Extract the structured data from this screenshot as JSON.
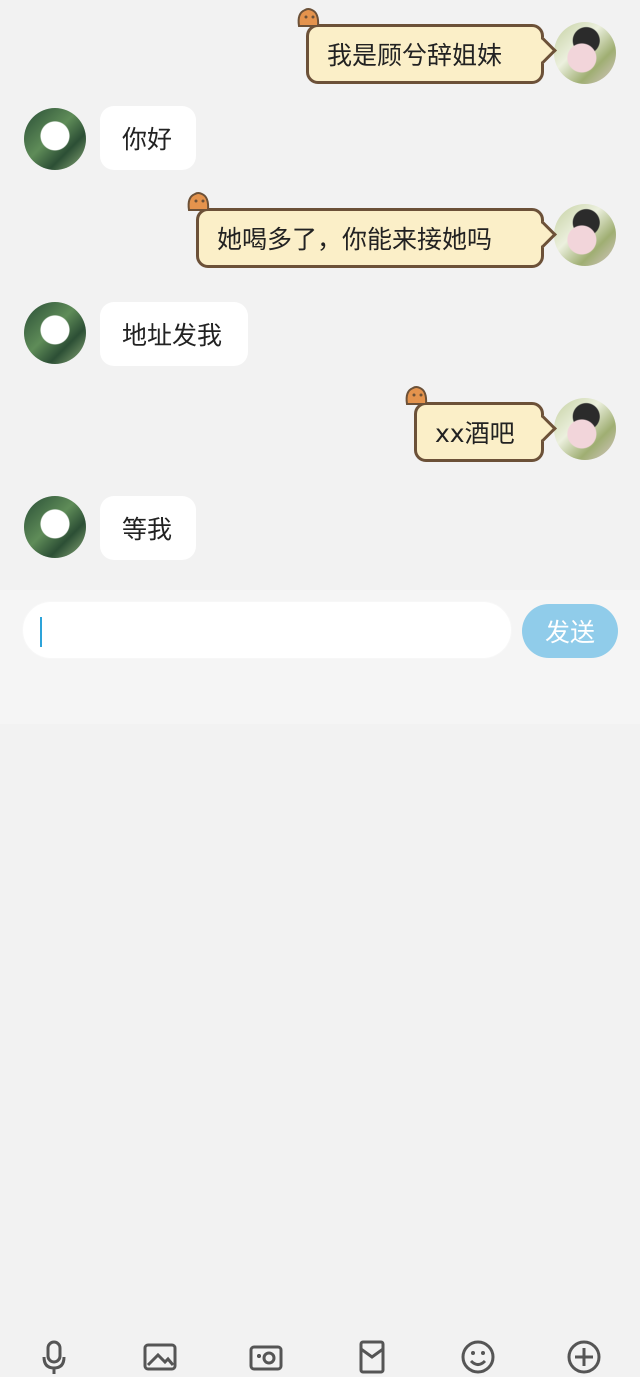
{
  "messages": [
    {
      "side": "right",
      "text": "我是顾兮辞姐妹"
    },
    {
      "side": "left",
      "text": "你好"
    },
    {
      "side": "right",
      "text": "她喝多了，你能来接她吗"
    },
    {
      "side": "left",
      "text": "地址发我"
    },
    {
      "side": "right",
      "text": "xx酒吧"
    },
    {
      "side": "left",
      "text": "等我"
    }
  ],
  "composer": {
    "send_label": "发送"
  },
  "toolbar": {
    "icons": [
      "microphone-icon",
      "image-icon",
      "camera-icon",
      "red-envelope-icon",
      "emoji-icon",
      "plus-icon"
    ]
  }
}
